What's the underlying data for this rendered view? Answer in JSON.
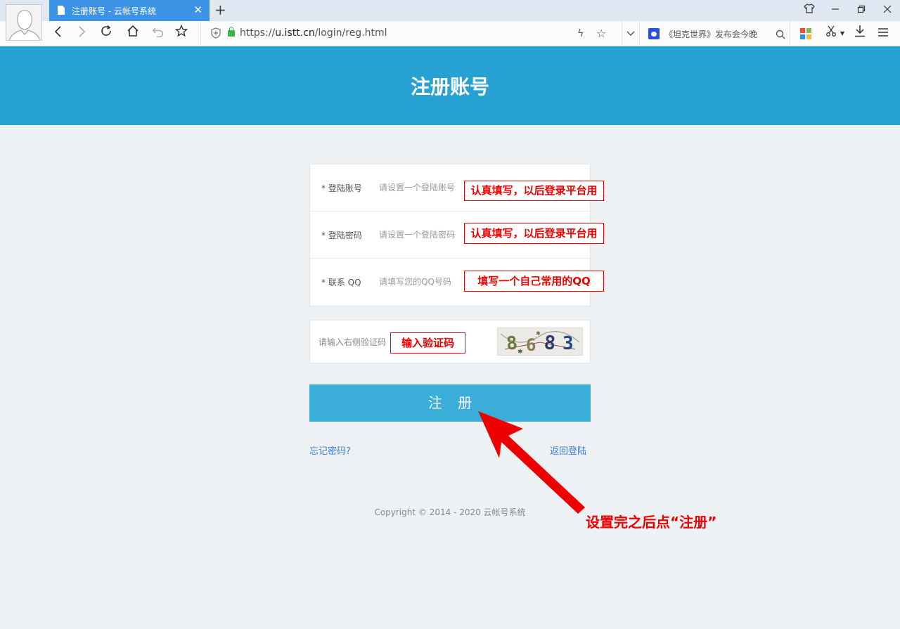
{
  "browser": {
    "tab": {
      "title": "注册账号 - 云帐号系统",
      "close": "✕"
    },
    "new_tab": "+",
    "address": {
      "scheme": "https://",
      "host": "u.istt.cn",
      "path": "/login/reg.html"
    },
    "search_text": "《坦克世界》发布会今晚"
  },
  "page": {
    "title": "注册账号",
    "fields": [
      {
        "label": "* 登陆账号",
        "placeholder": "请设置一个登陆账号"
      },
      {
        "label": "* 登陆密码",
        "placeholder": "请设置一个登陆密码"
      },
      {
        "label": "* 联系 QQ",
        "placeholder": "请填写您的QQ号码"
      }
    ],
    "captcha": {
      "placeholder": "请输入右侧验证码",
      "code": "8683"
    },
    "register_button": "注 册",
    "forgot_link": "忘记密码?",
    "back_link": "返回登陆",
    "copyright": "Copyright © 2014 - 2020 云帐号系统"
  },
  "annotations": {
    "account_note": "认真填写，以后登录平台用",
    "password_note": "认真填写，以后登录平台用",
    "qq_note": "填写一个自己常用的QQ",
    "captcha_note": "输入验证码",
    "callout": "设置完之后点“注册”",
    "color": "#ee0000"
  },
  "colors": {
    "header": "#27a1d2",
    "button": "#3badd9",
    "link": "#3d7ed6",
    "tab": "#3d94e6"
  }
}
